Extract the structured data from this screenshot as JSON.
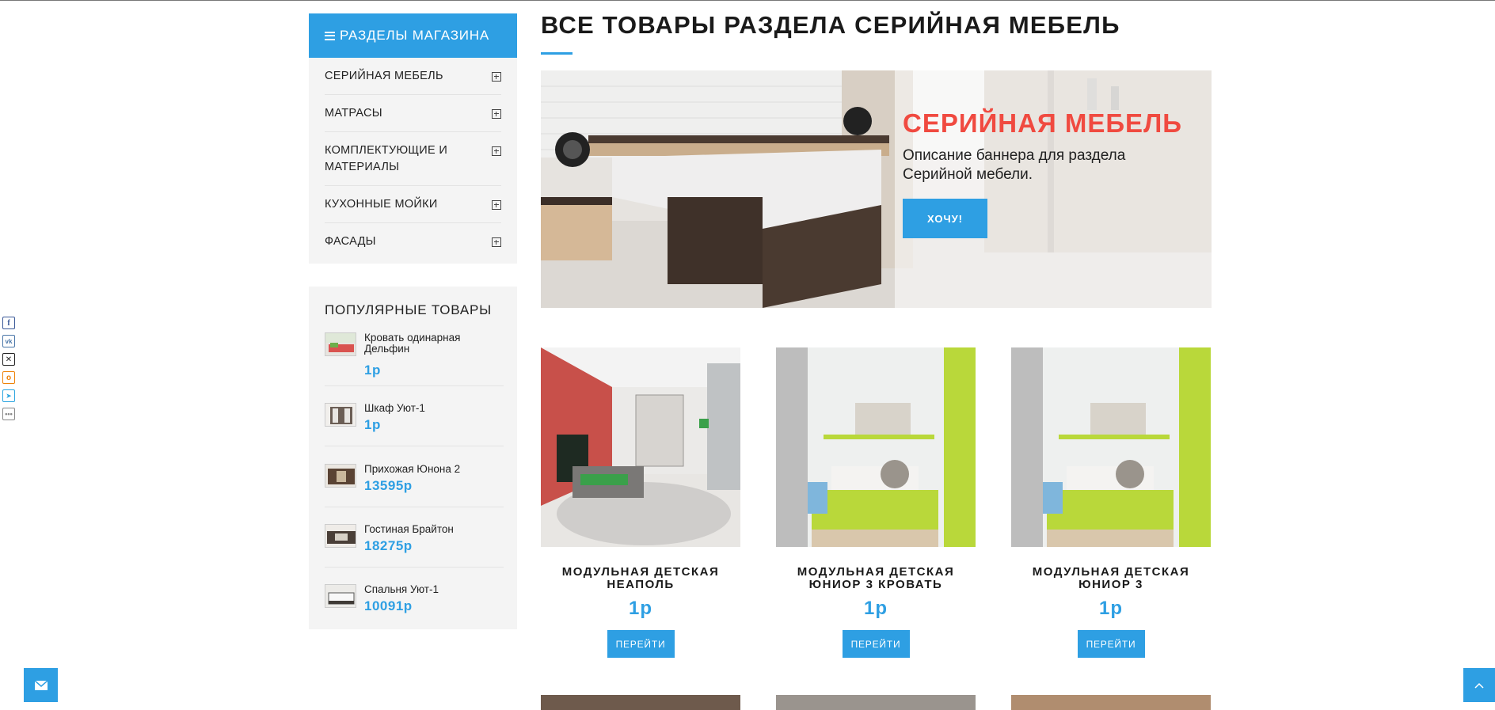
{
  "sidebar": {
    "catalog_title": "РАЗДЕЛЫ МАГАЗИНА",
    "categories": [
      {
        "label": "СЕРИЙНАЯ МЕБЕЛЬ"
      },
      {
        "label": "МАТРАСЫ"
      },
      {
        "label": "КОМПЛЕКТУЮЩИЕ И МАТЕРИАЛЫ"
      },
      {
        "label": "КУХОННЫЕ МОЙКИ"
      },
      {
        "label": "ФАСАДЫ"
      }
    ],
    "popular_title": "ПОПУЛЯРНЫЕ ТОВАРЫ",
    "popular": [
      {
        "name": "Кровать одинарная Дельфин",
        "price": "1р"
      },
      {
        "name": "Шкаф Уют-1",
        "price": "1р"
      },
      {
        "name": "Прихожая Юнона 2",
        "price": "13595р"
      },
      {
        "name": "Гостиная Брайтон",
        "price": "18275р"
      },
      {
        "name": "Спальня Уют-1",
        "price": "10091р"
      }
    ]
  },
  "main": {
    "title": "ВСЕ ТОВАРЫ РАЗДЕЛА СЕРИЙНАЯ МЕБЕЛЬ",
    "banner": {
      "heading": "СЕРИЙНАЯ МЕБЕЛЬ",
      "text": "Описание баннера для раздела Серийной мебели.",
      "button": "ХОЧУ!"
    },
    "products": [
      {
        "title": "МОДУЛЬНАЯ ДЕТСКАЯ НЕАПОЛЬ",
        "price": "1р",
        "button": "ПЕРЕЙТИ"
      },
      {
        "title": "МОДУЛЬНАЯ ДЕТСКАЯ ЮНИОР 3 КРОВАТЬ",
        "price": "1р",
        "button": "ПЕРЕЙТИ"
      },
      {
        "title": "МОДУЛЬНАЯ ДЕТСКАЯ ЮНИОР 3",
        "price": "1р",
        "button": "ПЕРЕЙТИ"
      }
    ]
  },
  "share_icons": [
    "facebook-icon",
    "vk-icon",
    "x-twitter-icon",
    "odnoklassniki-icon",
    "telegram-icon",
    "more-icon"
  ],
  "colors": {
    "accent": "#2e9fe3",
    "banner_heading": "#f04a40",
    "panel_bg": "#f4f4f4"
  }
}
